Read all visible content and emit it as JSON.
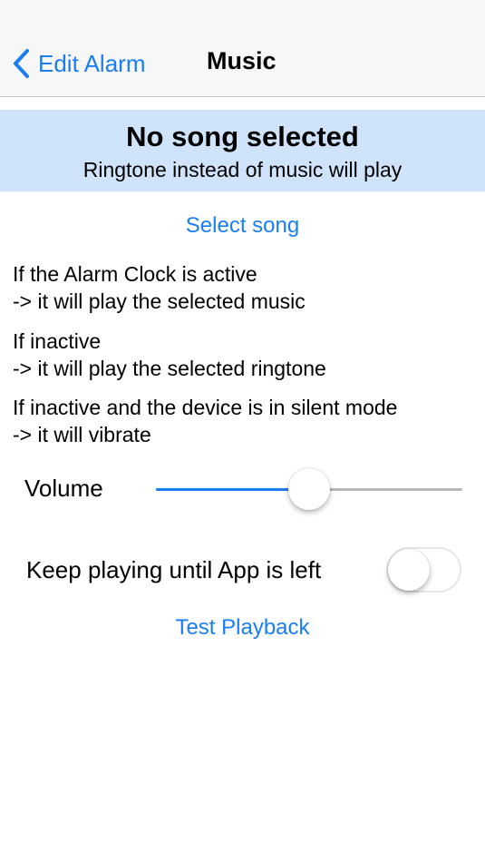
{
  "navbar": {
    "back_label": "Edit Alarm",
    "title": "Music",
    "back_icon": "chevron-left-icon"
  },
  "banner": {
    "title": "No song selected",
    "subtitle": "Ringtone instead of music will play"
  },
  "select_song_label": "Select song",
  "info": [
    {
      "line1": "If the Alarm Clock is active",
      "line2": "-> it will play the selected music"
    },
    {
      "line1": "If inactive",
      "line2": "-> it will play the selected ringtone"
    },
    {
      "line1": "If inactive and the device is in silent mode",
      "line2": "-> it will vibrate"
    }
  ],
  "volume": {
    "label": "Volume",
    "value": 0.5
  },
  "keep_playing": {
    "label": "Keep playing until App is left",
    "on": false
  },
  "test_playback_label": "Test Playback",
  "colors": {
    "accent": "#1a7ef1",
    "banner_bg": "#cfe4fb",
    "navbar_bg": "#f7f7f8"
  }
}
